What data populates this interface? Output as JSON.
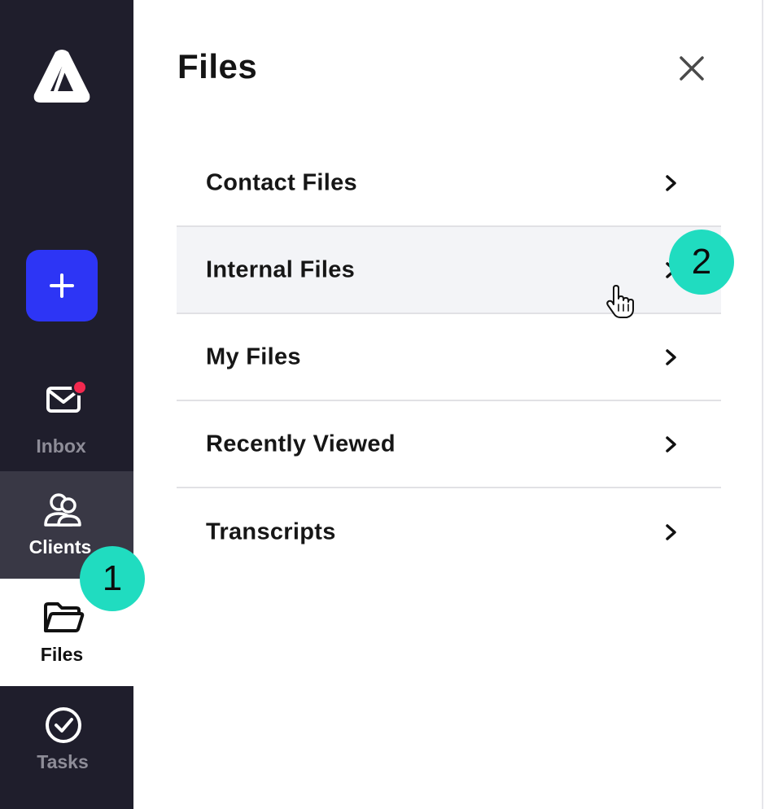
{
  "sidebar": {
    "nav": [
      {
        "id": "inbox",
        "label": "Inbox",
        "icon": "mail-icon",
        "has_notification": true
      },
      {
        "id": "clients",
        "label": "Clients",
        "icon": "users-icon"
      },
      {
        "id": "files",
        "label": "Files",
        "icon": "folder-icon",
        "active": true
      },
      {
        "id": "tasks",
        "label": "Tasks",
        "icon": "check-circle-icon"
      }
    ]
  },
  "panel": {
    "title": "Files",
    "items": [
      {
        "label": "Contact Files"
      },
      {
        "label": "Internal Files",
        "hovered": true
      },
      {
        "label": "My Files"
      },
      {
        "label": "Recently Viewed"
      },
      {
        "label": "Transcripts"
      }
    ]
  },
  "badges": {
    "step1": "1",
    "step2": "2"
  },
  "colors": {
    "sidebar_bg": "#1f1e2c",
    "accent_blue": "#2d35f5",
    "notification": "#f2294f",
    "badge": "#20dcc0",
    "hover_row": "#f3f4f7"
  }
}
